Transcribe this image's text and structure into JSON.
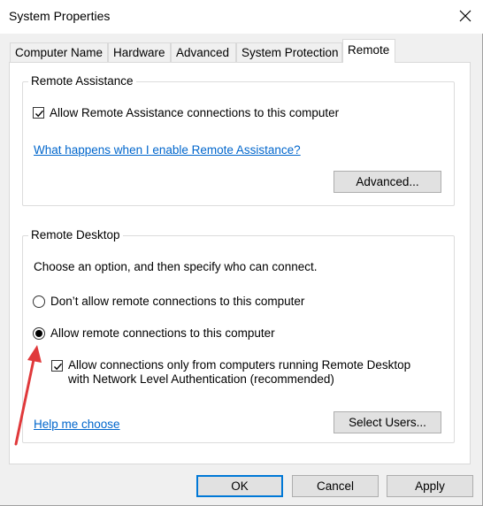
{
  "window": {
    "title": "System Properties"
  },
  "tabs": [
    {
      "label": "Computer Name"
    },
    {
      "label": "Hardware"
    },
    {
      "label": "Advanced"
    },
    {
      "label": "System Protection"
    },
    {
      "label": "Remote"
    }
  ],
  "remote_assistance": {
    "group_label": "Remote Assistance",
    "allow_label": "Allow Remote Assistance connections to this computer",
    "allow_checked": true,
    "link": "What happens when I enable Remote Assistance?",
    "advanced_button": "Advanced..."
  },
  "remote_desktop": {
    "group_label": "Remote Desktop",
    "instruction": "Choose an option, and then specify who can connect.",
    "option_dont_allow": "Don’t allow remote connections to this computer",
    "option_allow": "Allow remote connections to this computer",
    "selected_option": "allow",
    "nla_label_line1": "Allow connections only from computers running Remote Desktop",
    "nla_label_line2": "with Network Level Authentication (recommended)",
    "nla_checked": true,
    "help_link": "Help me choose",
    "select_users_button": "Select Users..."
  },
  "footer": {
    "ok": "OK",
    "cancel": "Cancel",
    "apply": "Apply"
  },
  "colors": {
    "link": "#0066cc",
    "accent": "#0078d7",
    "annotation_arrow": "#e0393b"
  },
  "icons": {
    "close": "close-icon",
    "checkmark": "checkmark-icon",
    "annotation": "red-arrow-annotation"
  }
}
